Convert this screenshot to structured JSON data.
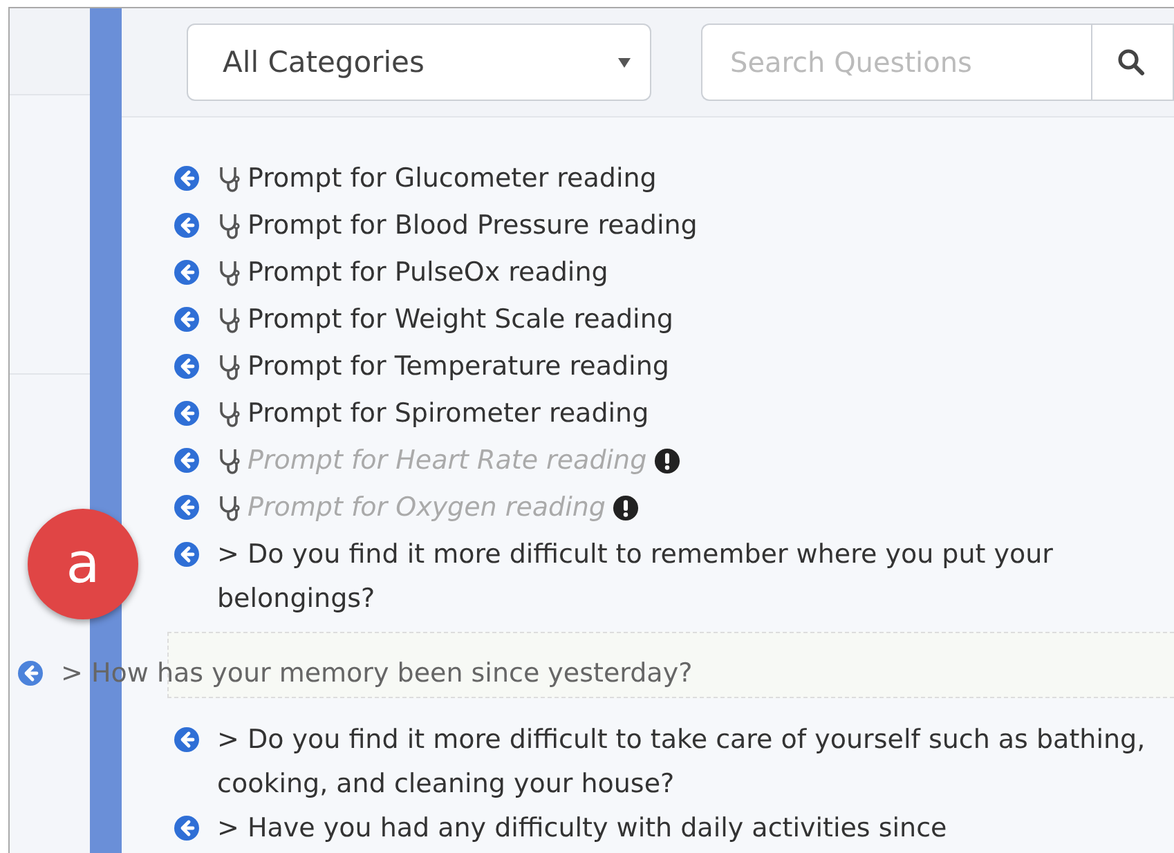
{
  "toolbar": {
    "category_select": {
      "value": "All Categories"
    },
    "search": {
      "placeholder": "Search Questions"
    }
  },
  "items": [
    {
      "kind": "prompt",
      "text": "Prompt for Glucometer reading",
      "disabled": false
    },
    {
      "kind": "prompt",
      "text": "Prompt for Blood Pressure reading",
      "disabled": false
    },
    {
      "kind": "prompt",
      "text": "Prompt for PulseOx reading",
      "disabled": false
    },
    {
      "kind": "prompt",
      "text": "Prompt for Weight Scale reading",
      "disabled": false
    },
    {
      "kind": "prompt",
      "text": "Prompt for Temperature reading",
      "disabled": false
    },
    {
      "kind": "prompt",
      "text": "Prompt for Spirometer reading",
      "disabled": false
    },
    {
      "kind": "prompt",
      "text": "Prompt for Heart Rate reading",
      "disabled": true
    },
    {
      "kind": "prompt",
      "text": "Prompt for Oxygen reading",
      "disabled": true
    },
    {
      "kind": "question",
      "text": "> Do you find it more difficult to remember where you put your belongings?"
    },
    {
      "kind": "placeholder"
    },
    {
      "kind": "question",
      "text": "> Do you find it more difficult to take care of yourself such as bathing, cooking, and cleaning your house?"
    },
    {
      "kind": "question",
      "text": "> Have you had any difficulty with daily activities since"
    }
  ],
  "dragged_item": {
    "text": "> How has your memory been since yesterday?"
  },
  "callout": {
    "label": "a"
  }
}
